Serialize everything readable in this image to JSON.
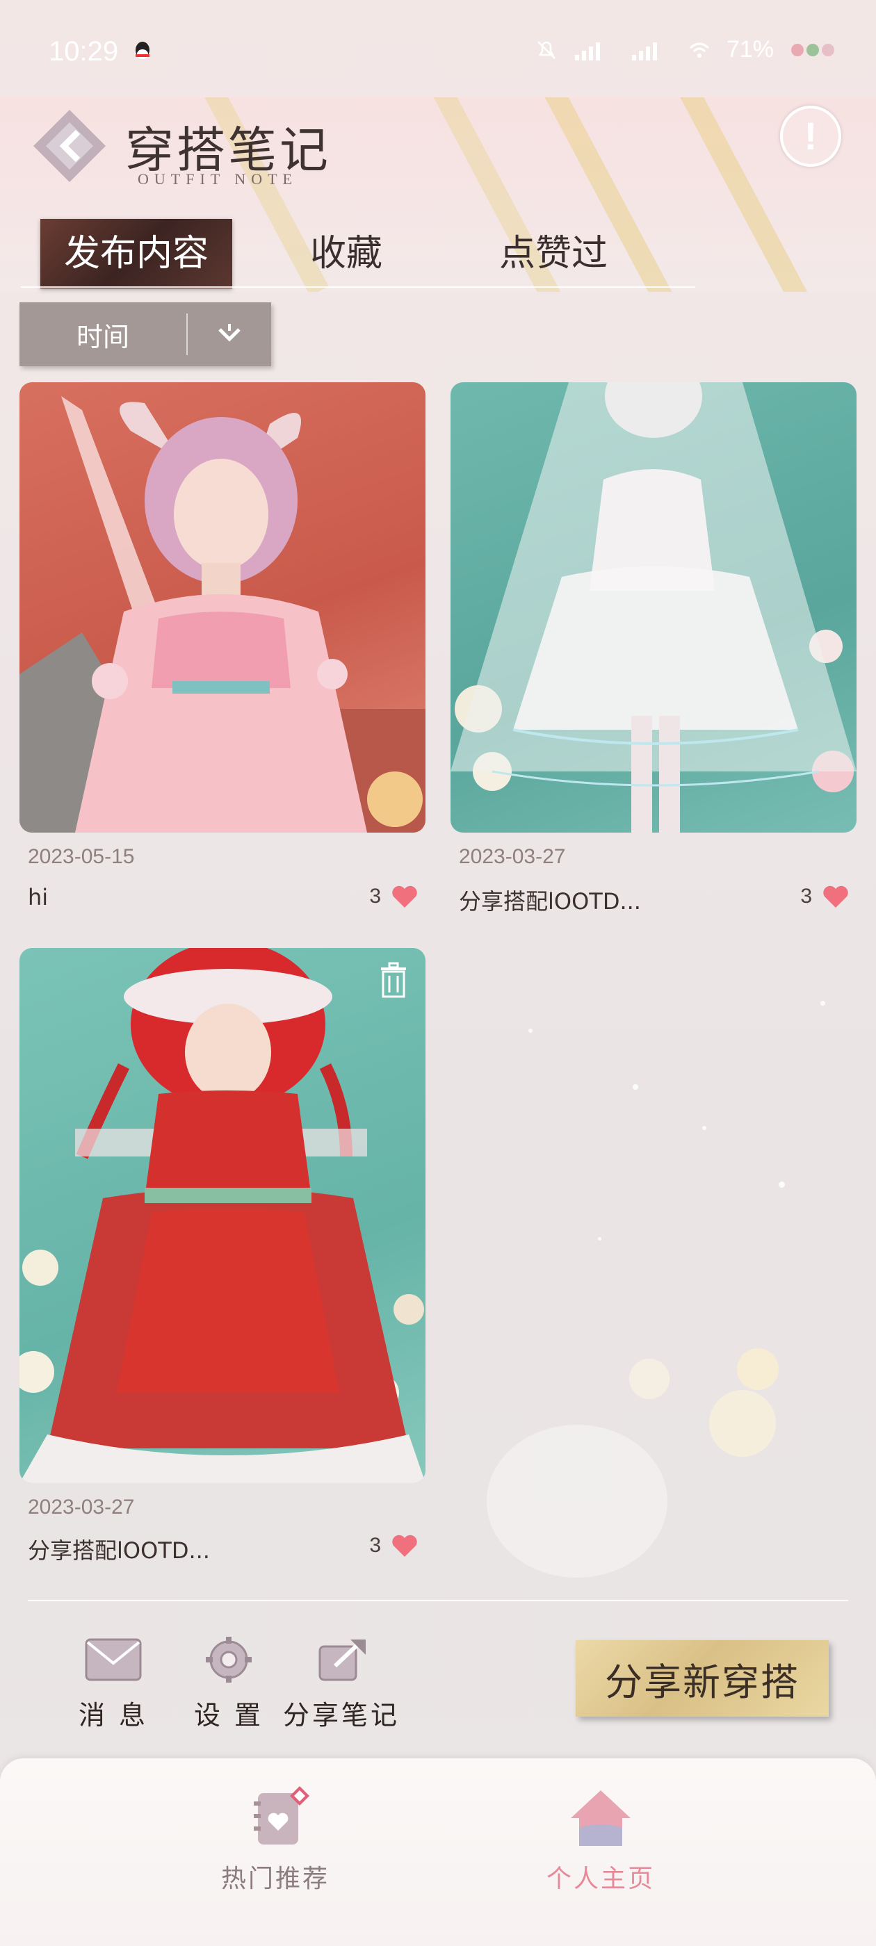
{
  "status": {
    "time": "10:29",
    "battery": "71%"
  },
  "header": {
    "title": "穿搭笔记",
    "subtitle": "OUTFIT NOTE",
    "info_symbol": "!"
  },
  "tabs": [
    {
      "label": "发布内容",
      "active": true
    },
    {
      "label": "收藏",
      "active": false
    },
    {
      "label": "点赞过",
      "active": false
    }
  ],
  "sort": {
    "label": "时间"
  },
  "posts": [
    {
      "date": "2023-05-15",
      "title": "hi",
      "likes": "3"
    },
    {
      "date": "2023-03-27",
      "title": "分享搭配lOOTD...",
      "likes": "3"
    },
    {
      "date": "2023-03-27",
      "title": "分享搭配lOOTD...",
      "likes": "3"
    }
  ],
  "toolbar": {
    "message": "消 息",
    "settings": "设 置",
    "share_note": "分享笔记",
    "share_new": "分享新穿搭"
  },
  "nav": {
    "hot": "热门推荐",
    "home": "个人主页"
  },
  "colors": {
    "heart": "#f0707e",
    "accent_home": "#e89aa7",
    "gold_button": "#d9c086"
  }
}
